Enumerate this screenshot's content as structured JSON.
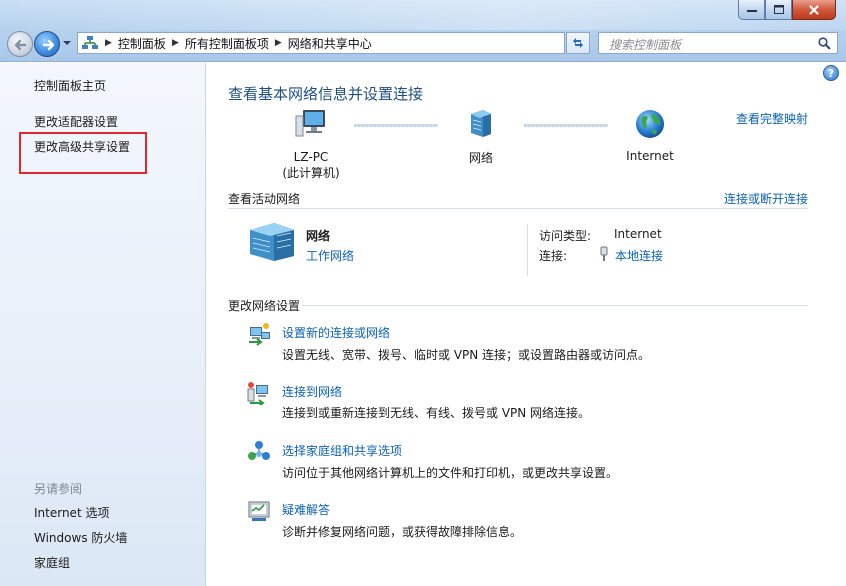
{
  "window": {
    "buttons": {
      "minimize": "minimize-icon",
      "maximize": "maximize-icon",
      "close": "close-icon"
    }
  },
  "address_bar": {
    "breadcrumbs": [
      "控制面板",
      "所有控制面板项",
      "网络和共享中心"
    ]
  },
  "search": {
    "placeholder": "搜索控制面板"
  },
  "sidebar": {
    "items": [
      "控制面板主页",
      "更改适配器设置",
      "更改高级共享设置"
    ],
    "see_also_label": "另请参阅",
    "see_also": [
      "Internet 选项",
      "Windows 防火墙",
      "家庭组"
    ]
  },
  "main": {
    "title": "查看基本网络信息并设置连接",
    "view_full_map": "查看完整映射",
    "map_nodes": [
      {
        "label": "LZ-PC",
        "sublabel": "(此计算机)",
        "icon": "computer-icon"
      },
      {
        "label": "网络",
        "icon": "network-icon"
      },
      {
        "label": "Internet",
        "icon": "globe-icon"
      }
    ],
    "active_networks_label": "查看活动网络",
    "connect_disconnect": "连接或断开连接",
    "active_network": {
      "name": "网络",
      "type": "工作网络",
      "access_type_label": "访问类型:",
      "access_type_value": "Internet",
      "connections_label": "连接:",
      "connections_value": "本地连接"
    },
    "change_settings_label": "更改网络设置",
    "tasks": [
      {
        "title": "设置新的连接或网络",
        "desc": "设置无线、宽带、拨号、临时或 VPN 连接；或设置路由器或访问点。",
        "icon": "new-connection-icon"
      },
      {
        "title": "连接到网络",
        "desc": "连接到或重新连接到无线、有线、拨号或 VPN 网络连接。",
        "icon": "connect-network-icon"
      },
      {
        "title": "选择家庭组和共享选项",
        "desc": "访问位于其他网络计算机上的文件和打印机，或更改共享设置。",
        "icon": "homegroup-icon"
      },
      {
        "title": "疑难解答",
        "desc": "诊断并修复网络问题，或获得故障排除信息。",
        "icon": "troubleshoot-icon"
      }
    ]
  },
  "colors": {
    "link": "#0b62b5",
    "title": "#1e4e86",
    "highlight_box": "#e0282c"
  }
}
